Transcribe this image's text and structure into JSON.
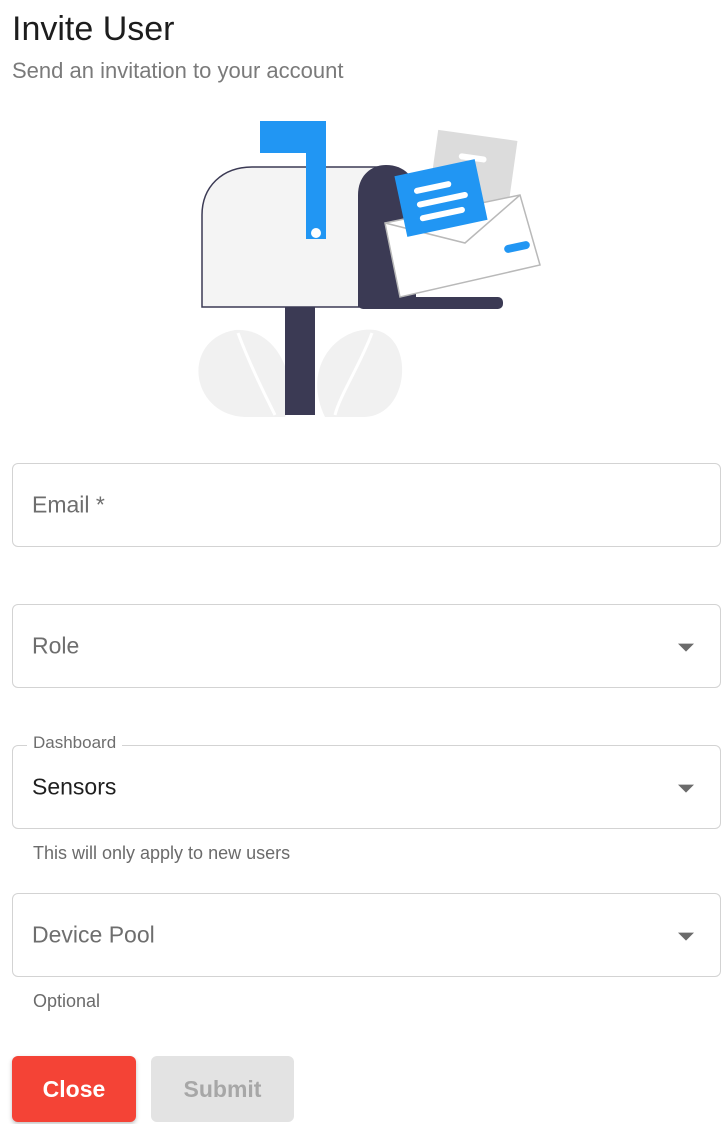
{
  "header": {
    "title": "Invite User",
    "subtitle": "Send an invitation to your account"
  },
  "illustration": {
    "icon": "mailbox-envelope-illustration",
    "colors": {
      "accent": "#2196f3",
      "dark": "#3b3a54",
      "light": "#efefef"
    }
  },
  "form": {
    "email": {
      "placeholder": "Email *",
      "value": ""
    },
    "role": {
      "placeholder": "Role",
      "value": ""
    },
    "dashboard": {
      "label": "Dashboard",
      "value": "Sensors",
      "helper": "This will only apply to new users"
    },
    "device_pool": {
      "placeholder": "Device Pool",
      "value": "",
      "helper": "Optional"
    }
  },
  "actions": {
    "close_label": "Close",
    "submit_label": "Submit",
    "close_color": "#f44336",
    "submit_disabled": true
  }
}
